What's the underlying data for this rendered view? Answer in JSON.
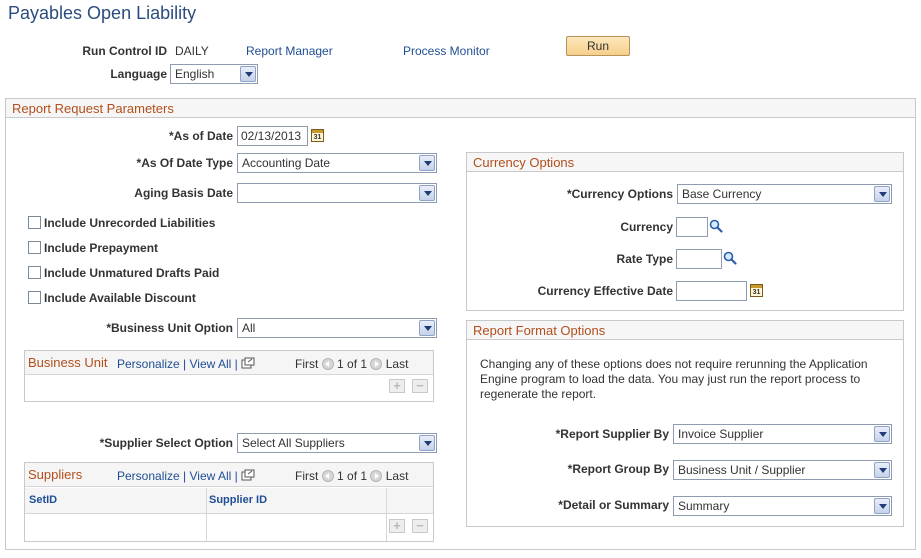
{
  "page": {
    "title": "Payables Open Liability",
    "run_control_label": "Run Control ID",
    "run_control_value": "DAILY",
    "report_manager_link": "Report Manager",
    "process_monitor_link": "Process Monitor",
    "run_button": "Run",
    "language_label": "Language",
    "language_value": "English"
  },
  "params": {
    "section_title": "Report Request Parameters",
    "as_of_date_label": "*As of Date",
    "as_of_date_value": "02/13/2013",
    "as_of_date_type_label": "*As Of Date Type",
    "as_of_date_type_value": "Accounting Date",
    "aging_basis_label": "Aging Basis Date",
    "aging_basis_value": "",
    "checkboxes": [
      {
        "label": "Include Unrecorded Liabilities",
        "checked": false
      },
      {
        "label": "Include Prepayment",
        "checked": false
      },
      {
        "label": "Include Unmatured Drafts Paid",
        "checked": false
      },
      {
        "label": "Include Available Discount",
        "checked": false
      }
    ],
    "bu_option_label": "*Business Unit Option",
    "bu_option_value": "All",
    "supplier_option_label": "*Supplier Select Option",
    "supplier_option_value": "Select All Suppliers"
  },
  "business_unit_grid": {
    "title": "Business Unit",
    "personalize": "Personalize",
    "separator": "|",
    "view_all": "View All",
    "first": "First",
    "range": "1 of 1",
    "last": "Last",
    "add": "+",
    "remove": "−"
  },
  "suppliers_grid": {
    "title": "Suppliers",
    "personalize": "Personalize",
    "separator": "|",
    "view_all": "View All",
    "first": "First",
    "range": "1 of 1",
    "last": "Last",
    "columns": [
      "SetID",
      "Supplier ID"
    ],
    "add": "+",
    "remove": "−"
  },
  "currency": {
    "section_title": "Currency Options",
    "options_label": "*Currency Options",
    "options_value": "Base Currency",
    "currency_label": "Currency",
    "currency_value": "",
    "rate_type_label": "Rate Type",
    "rate_type_value": "",
    "effective_date_label": "Currency Effective Date",
    "effective_date_value": ""
  },
  "format": {
    "section_title": "Report Format Options",
    "description": "Changing any of these options does not require rerunning the Application Engine program to load the data. You may just run the report process to regenerate the report.",
    "supplier_by_label": "*Report Supplier By",
    "supplier_by_value": "Invoice Supplier",
    "group_by_label": "*Report Group By",
    "group_by_value": "Business Unit / Supplier",
    "detail_label": "*Detail or Summary",
    "detail_value": "Summary"
  },
  "icons": {
    "calendar": "calendar-icon",
    "lookup": "magnifier-icon",
    "zoom": "new-window-icon",
    "calendar_glyph": "31"
  },
  "colors": {
    "title": "#2b4d7d",
    "section_title": "#b24f1c",
    "link": "#1f4e94",
    "run_button": "#f6cf8a"
  }
}
